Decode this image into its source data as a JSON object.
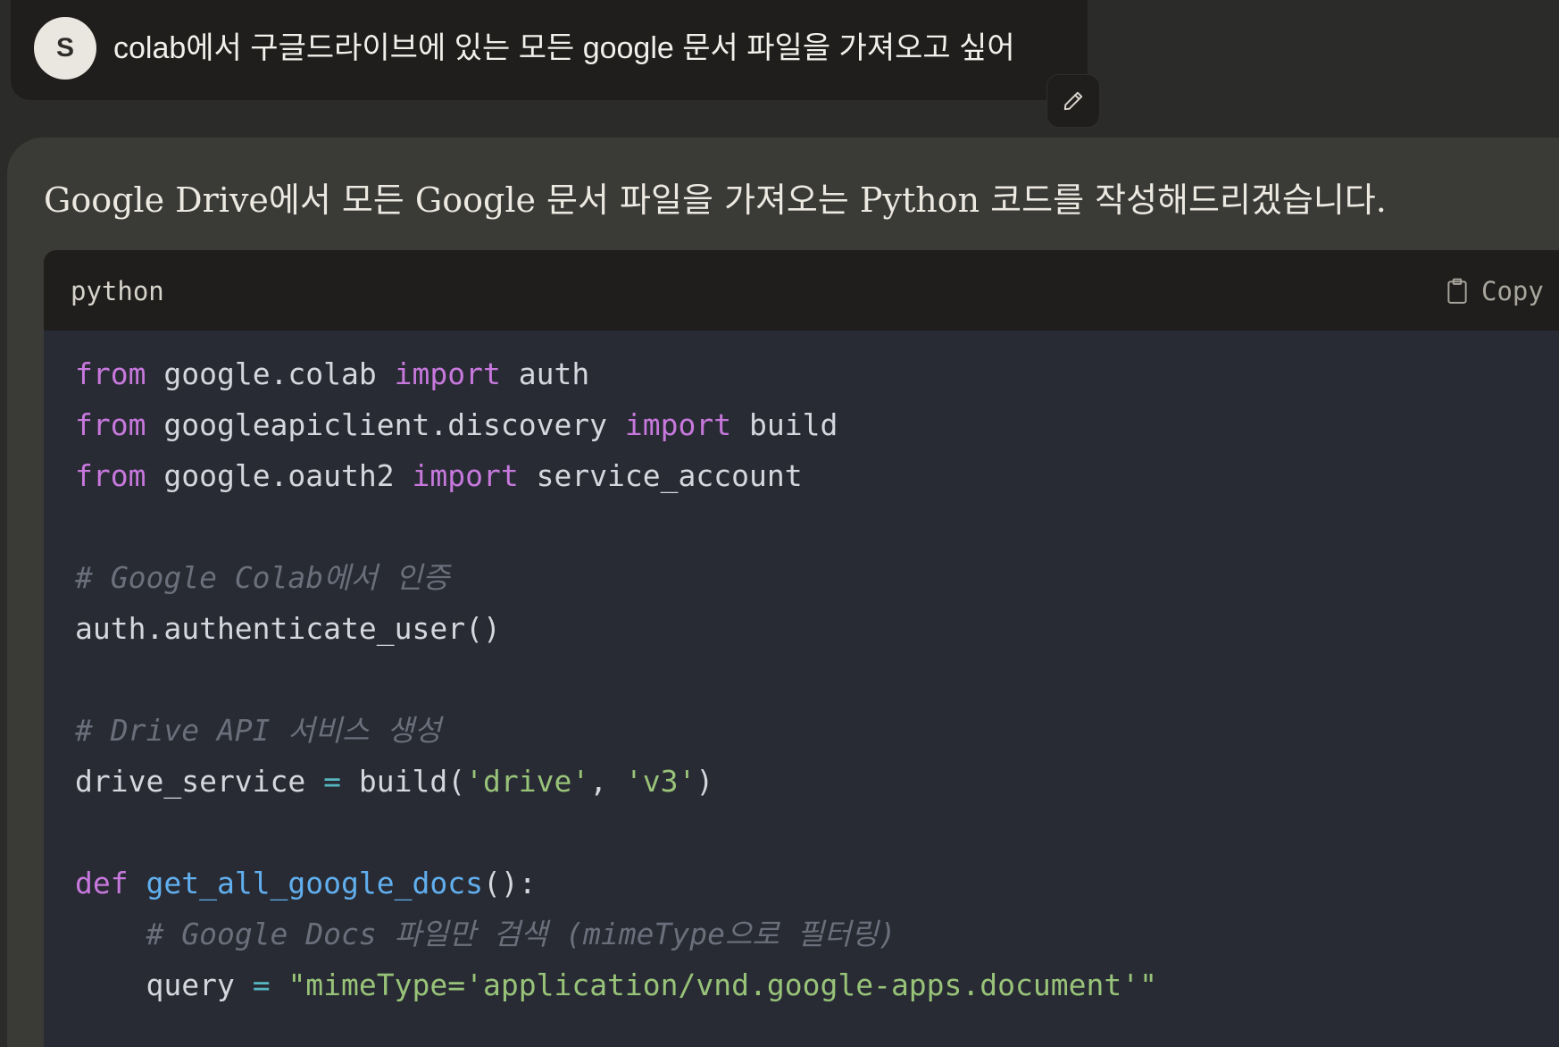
{
  "user_message": {
    "avatar_initial": "S",
    "text": "colab에서 구글드라이브에 있는 모든 google 문서 파일을 가져오고 싶어"
  },
  "assistant_message": {
    "intro": "Google Drive에서 모든 Google 문서 파일을 가져오는 Python 코드를 작성해드리겠습니다."
  },
  "code_block": {
    "language": "python",
    "copy_label": "Copy",
    "lines": [
      [
        {
          "t": "kw",
          "v": "from"
        },
        {
          "t": "txt",
          "v": " google.colab "
        },
        {
          "t": "kw",
          "v": "import"
        },
        {
          "t": "txt",
          "v": " auth"
        }
      ],
      [
        {
          "t": "kw",
          "v": "from"
        },
        {
          "t": "txt",
          "v": " googleapiclient.discovery "
        },
        {
          "t": "kw",
          "v": "import"
        },
        {
          "t": "txt",
          "v": " build"
        }
      ],
      [
        {
          "t": "kw",
          "v": "from"
        },
        {
          "t": "txt",
          "v": " google.oauth2 "
        },
        {
          "t": "kw",
          "v": "import"
        },
        {
          "t": "txt",
          "v": " service_account"
        }
      ],
      [],
      [
        {
          "t": "cm",
          "v": "# Google Colab에서 인증"
        }
      ],
      [
        {
          "t": "txt",
          "v": "auth.authenticate_user()"
        }
      ],
      [],
      [
        {
          "t": "cm",
          "v": "# Drive API 서비스 생성"
        }
      ],
      [
        {
          "t": "txt",
          "v": "drive_service "
        },
        {
          "t": "op",
          "v": "="
        },
        {
          "t": "txt",
          "v": " build("
        },
        {
          "t": "str",
          "v": "'drive'"
        },
        {
          "t": "txt",
          "v": ", "
        },
        {
          "t": "str",
          "v": "'v3'"
        },
        {
          "t": "txt",
          "v": ")"
        }
      ],
      [],
      [
        {
          "t": "kw",
          "v": "def"
        },
        {
          "t": "txt",
          "v": " "
        },
        {
          "t": "fn",
          "v": "get_all_google_docs"
        },
        {
          "t": "txt",
          "v": "():"
        }
      ],
      [
        {
          "t": "txt",
          "v": "    "
        },
        {
          "t": "cm",
          "v": "# Google Docs 파일만 검색 (mimeType으로 필터링)"
        }
      ],
      [
        {
          "t": "txt",
          "v": "    query "
        },
        {
          "t": "op",
          "v": "="
        },
        {
          "t": "txt",
          "v": " "
        },
        {
          "t": "str",
          "v": "\"mimeType='application/vnd.google-apps.document'\""
        }
      ]
    ]
  },
  "icons": {
    "edit": "pencil-icon",
    "copy": "clipboard-icon"
  },
  "colors": {
    "background": "#2b2b29",
    "user_bubble": "#1f1e1c",
    "assistant_card": "#3a3a37",
    "code_bg": "#282b33",
    "keyword": "#c778dd",
    "string": "#98c379",
    "function": "#61afef",
    "operator": "#56b6c2",
    "comment": "#6a6f7b"
  }
}
